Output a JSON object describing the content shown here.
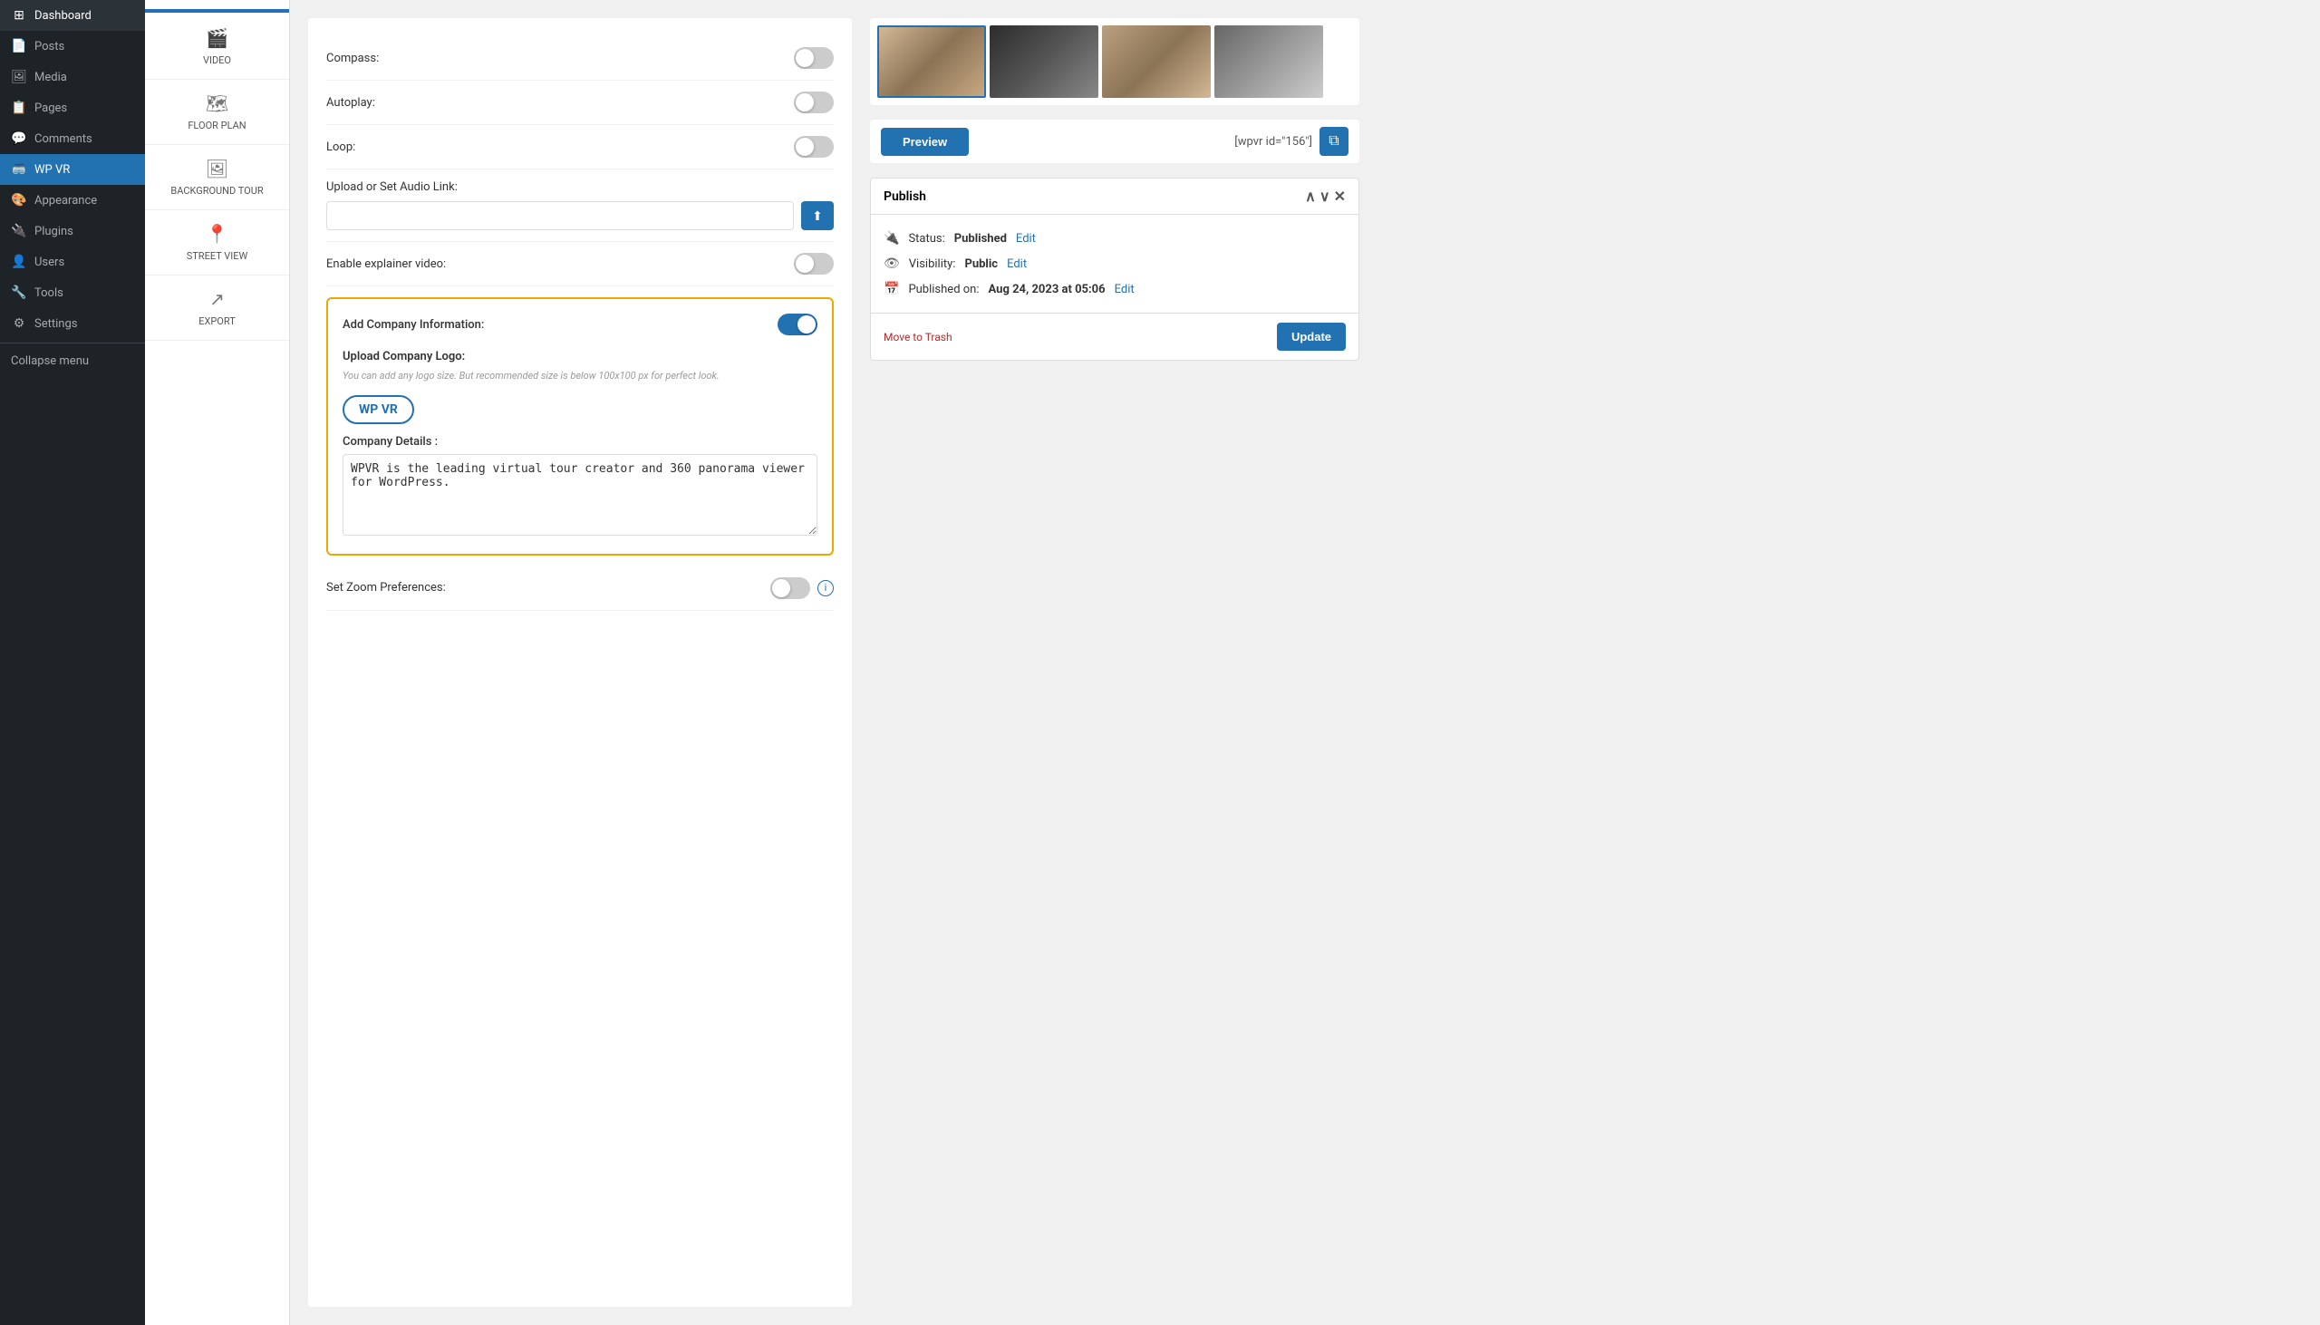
{
  "sidebar": {
    "items": [
      {
        "label": "Dashboard",
        "icon": "⊞",
        "active": false
      },
      {
        "label": "Posts",
        "icon": "📄",
        "active": false
      },
      {
        "label": "Media",
        "icon": "🖼",
        "active": false
      },
      {
        "label": "Pages",
        "icon": "📋",
        "active": false
      },
      {
        "label": "Comments",
        "icon": "💬",
        "active": false
      },
      {
        "label": "WP VR",
        "icon": "🥽",
        "active": true
      },
      {
        "label": "Appearance",
        "icon": "🎨",
        "active": false
      },
      {
        "label": "Plugins",
        "icon": "🔌",
        "active": false
      },
      {
        "label": "Users",
        "icon": "👤",
        "active": false
      },
      {
        "label": "Tools",
        "icon": "🔧",
        "active": false
      },
      {
        "label": "Settings",
        "icon": "⚙",
        "active": false
      }
    ],
    "collapse_label": "Collapse menu"
  },
  "left_panel": {
    "items": [
      {
        "label": "VIDEO",
        "icon": "🎬"
      },
      {
        "label": "FLOOR PLAN",
        "icon": "🗺"
      },
      {
        "label": "BACKGROUND TOUR",
        "icon": "🖼"
      },
      {
        "label": "STREET VIEW",
        "icon": "📍"
      },
      {
        "label": "EXPORT",
        "icon": "↗"
      }
    ]
  },
  "form": {
    "compass_label": "Compass:",
    "compass_enabled": false,
    "autoplay_label": "Autoplay:",
    "autoplay_enabled": false,
    "loop_label": "Loop:",
    "loop_enabled": false,
    "audio_label": "Upload or Set Audio Link:",
    "audio_placeholder": "",
    "explainer_video_label": "Enable explainer video:",
    "explainer_video_enabled": false,
    "company_info": {
      "label": "Add Company Information:",
      "enabled": true,
      "upload_logo_title": "Upload Company Logo:",
      "upload_logo_hint": "You can add any logo size. But recommended size is below 100x100 px for perfect look.",
      "logo_text": "WP VR",
      "company_details_label": "Company Details :",
      "company_details_value": "WPVR is the leading virtual tour creator and 360 panorama viewer for WordPress."
    },
    "zoom_label": "Set Zoom Preferences:"
  },
  "gallery": {
    "thumbs": [
      {
        "class": "thumb-1",
        "active": true
      },
      {
        "class": "thumb-2",
        "active": false
      },
      {
        "class": "thumb-3",
        "active": false
      },
      {
        "class": "thumb-4",
        "active": false
      }
    ]
  },
  "preview": {
    "button_label": "Preview",
    "shortcode": "[wpvr id=\"156\"]",
    "copy_icon": "⧉"
  },
  "publish": {
    "title": "Publish",
    "status_label": "Status:",
    "status_value": "Published",
    "status_edit": "Edit",
    "visibility_label": "Visibility:",
    "visibility_value": "Public",
    "visibility_edit": "Edit",
    "published_label": "Published on:",
    "published_value": "Aug 24, 2023 at 05:06",
    "published_edit": "Edit",
    "move_trash_label": "Move to Trash",
    "update_label": "Update"
  }
}
